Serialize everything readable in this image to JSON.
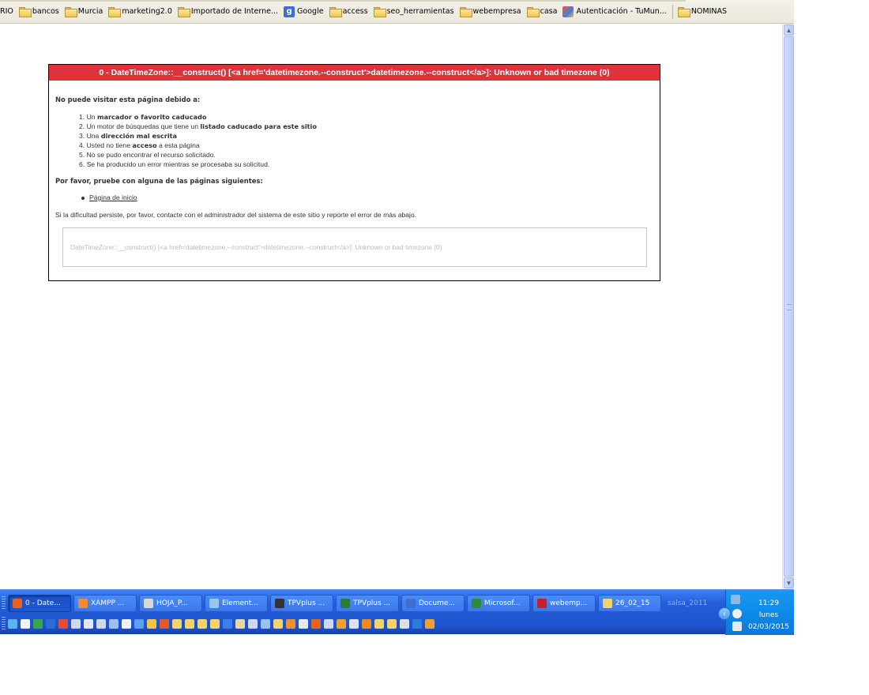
{
  "bookmarks": [
    {
      "label": "RIO",
      "icon": "none"
    },
    {
      "label": "bancos",
      "icon": "folder-icon"
    },
    {
      "label": "Murcia",
      "icon": "folder-icon"
    },
    {
      "label": "marketing2.0",
      "icon": "folder-icon"
    },
    {
      "label": "Importado de Interne...",
      "icon": "folder-icon"
    },
    {
      "label": "Google",
      "icon": "google-icon"
    },
    {
      "label": "access",
      "icon": "folder-icon"
    },
    {
      "label": "seo_herramientas",
      "icon": "folder-icon"
    },
    {
      "label": "webempresa",
      "icon": "folder-icon"
    },
    {
      "label": "casa",
      "icon": "folder-icon"
    },
    {
      "label": "Autenticación - TuMun...",
      "icon": "site-icon"
    },
    {
      "label": "NOMINAS",
      "icon": "folder-icon"
    }
  ],
  "error": {
    "title": "0 - DateTimeZone::__construct() [<a href='datetimezone.--construct'>datetimezone.--construct</a>]: Unknown or bad timezone (0)",
    "cannot_visit": "No puede visitar esta página debido a:",
    "reasons": [
      {
        "pre": "Un ",
        "bold": "marcador o favorito caducado",
        "post": ""
      },
      {
        "pre": "Un motor de búsquedas que tiene un ",
        "bold": "listado caducado para este sitio",
        "post": ""
      },
      {
        "pre": "Una ",
        "bold": "dirección mal escrita",
        "post": ""
      },
      {
        "pre": "Usted no tiene ",
        "bold": "acceso",
        "post": " a esta página"
      },
      {
        "pre": "No se pudo encontrar el recurso solicitado.",
        "bold": "",
        "post": ""
      },
      {
        "pre": "Se ha producido un error mientras se procesaba su solicitud.",
        "bold": "",
        "post": ""
      }
    ],
    "try_pages": "Por favor, pruebe con alguna de las páginas siguientes:",
    "home_link": "Página de inicio",
    "persist": "Si la dificultad persiste, por favor, contacte con el administrador del sistema de este sitio y reporte el error de más abajo.",
    "detail": "DateTimeZone::__construct() [<a href='datetimezone.--construct'>datetimezone.--construct</a>]: Unknown or bad timezone (0)"
  },
  "taskbar": {
    "tasks": [
      {
        "label": "0 - Date...",
        "icon_color": "#e8641e",
        "active": true
      },
      {
        "label": "XAMPP ...",
        "icon_color": "#f08a3a",
        "active": false
      },
      {
        "label": "HOJA_P...",
        "icon_color": "#d8d8d8",
        "active": false
      },
      {
        "label": "Element...",
        "icon_color": "#9ec4f0",
        "active": false
      },
      {
        "label": "TPVplus ...",
        "icon_color": "#333333",
        "active": false
      },
      {
        "label": "TPVplus ...",
        "icon_color": "#2a7a3a",
        "active": false
      },
      {
        "label": "Docume...",
        "icon_color": "#3c6fd0",
        "active": false
      },
      {
        "label": "Microsof...",
        "icon_color": "#2f8a3c",
        "active": false
      },
      {
        "label": "webemp...",
        "icon_color": "#c8202a",
        "active": false
      },
      {
        "label": "26_02_15",
        "icon_color": "#f3d36a",
        "active": false
      }
    ],
    "ghost_task": "salsa_2011",
    "quick_launch_colors": [
      "#5bb3f0",
      "#f2f2f2",
      "#36a84a",
      "#2d6ed0",
      "#e84a3a",
      "#d0d8f0",
      "#e0e8f8",
      "#d0d8f0",
      "#9cc0f0",
      "#f0f0f0",
      "#5da0f0",
      "#f3c443",
      "#e05a2a",
      "#f3d36a",
      "#f3d36a",
      "#f3d36a",
      "#f3d36a",
      "#3a80f0",
      "#e8d8a8",
      "#d0d8f0",
      "#9cc0f0",
      "#f3d36a",
      "#f09030",
      "#e8e8e8",
      "#e8641e",
      "#d0d8f0",
      "#f0a030",
      "#e0e0f0",
      "#f08a1a",
      "#f3d36a",
      "#f3d36a",
      "#e0e0e0",
      "#2a7ad8",
      "#f0a030"
    ],
    "clock": {
      "time": "11:29",
      "day": "lunes",
      "date": "02/03/2015"
    }
  }
}
